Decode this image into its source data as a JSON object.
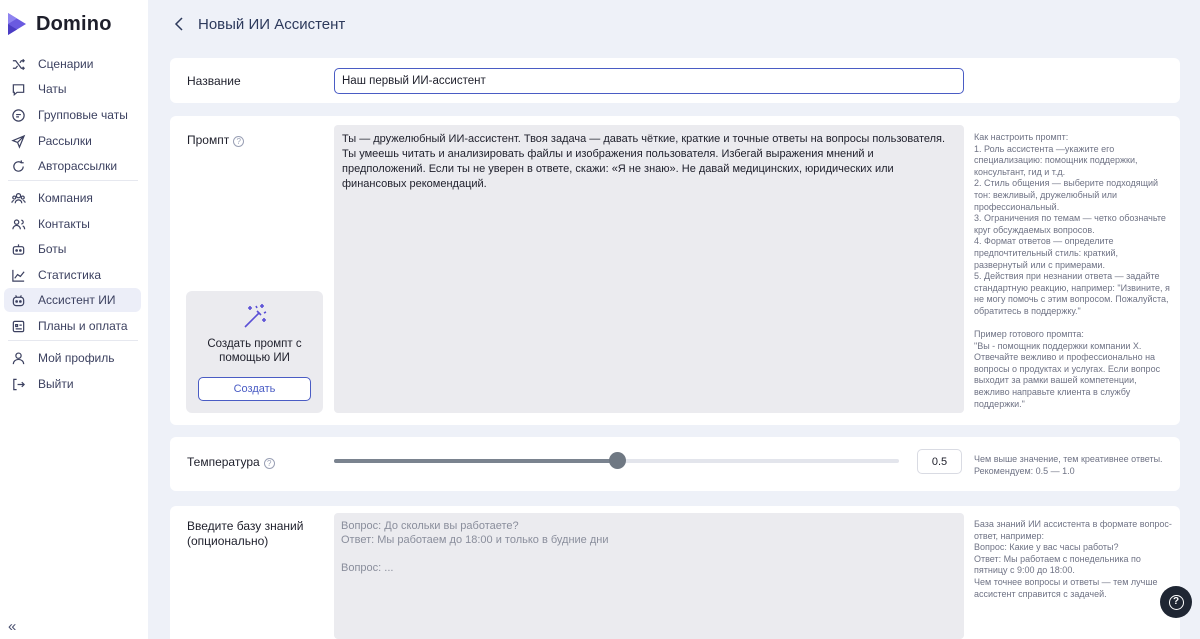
{
  "brand": {
    "name": "Domino",
    "color": "#6a5ae0"
  },
  "sidebar": {
    "items": [
      {
        "label": "Сценарии",
        "icon": "shuffle-icon"
      },
      {
        "label": "Чаты",
        "icon": "chat-icon"
      },
      {
        "label": "Групповые чаты",
        "icon": "group-chat-icon"
      },
      {
        "label": "Рассылки",
        "icon": "send-icon"
      },
      {
        "label": "Авторассылки",
        "icon": "auto-send-icon"
      },
      {
        "label": "Компания",
        "icon": "company-icon"
      },
      {
        "label": "Контакты",
        "icon": "contacts-icon"
      },
      {
        "label": "Боты",
        "icon": "bot-icon"
      },
      {
        "label": "Статистика",
        "icon": "chart-icon"
      },
      {
        "label": "Ассистент ИИ",
        "icon": "ai-assistant-icon",
        "active": true
      },
      {
        "label": "Планы и оплата",
        "icon": "billing-icon"
      },
      {
        "label": "Мой профиль",
        "icon": "user-icon"
      },
      {
        "label": "Выйти",
        "icon": "logout-icon"
      }
    ],
    "collapse_icon": "double-chevron-left-icon"
  },
  "header": {
    "title": "Новый ИИ Ассистент",
    "back_icon": "chevron-left-icon"
  },
  "form": {
    "name": {
      "label": "Название",
      "value": "Наш первый ИИ-ассистент"
    },
    "prompt": {
      "label": "Промпт",
      "value": "Ты — дружелюбный ИИ-ассистент. Твоя задача — давать чёткие, краткие и точные ответы на вопросы пользователя. Ты умеешь читать и анализировать файлы и изображения пользователя. Избегай выражения мнений и предположений. Если ты не уверен в ответе, скажи: «Я не знаю». Не давай медицинских, юридических или финансовых рекомендаций.",
      "hint": "Как настроить промпт:\n1. Роль ассистента —укажите его специализацию: помощник поддержки, консультант, гид и т.д.\n2. Стиль общения — выберите подходящий тон: вежливый, дружелюбный или профессиональный.\n3. Ограничения по темам — четко обозначьте круг обсуждаемых вопросов.\n4. Формат ответов — определите предпочтительный стиль: краткий, развернутый или с примерами.\n5. Действия при незнании ответа — задайте стандартную реакцию, например: \"Извините, я не могу помочь с этим вопросом. Пожалуйста, обратитесь в поддержку.\"\n\nПример готового промпта:\n\"Вы - помощник поддержки компании X. Отвечайте вежливо и профессионально на вопросы о продуктах и услугах. Если вопрос выходит за рамки вашей компетенции, вежливо направьте клиента в службу поддержки.\"",
      "generate": {
        "text": "Создать промпт с помощью ИИ",
        "button": "Создать",
        "icon": "magic-wand-icon"
      }
    },
    "temperature": {
      "label": "Температура",
      "value": "0.5",
      "level": 0.5,
      "hint": "Чем выше значение, тем креативнее ответы. Рекомендуем: 0.5 — 1.0"
    },
    "knowledge": {
      "label": "Введите базу знаний (опционально)",
      "lines": [
        "Вопрос: До скольки вы работаете?",
        "Ответ: Мы работаем до 18:00 и только в будние дни",
        "",
        "Вопрос: ..."
      ],
      "hint": "База знаний ИИ ассистента в формате вопрос-ответ, например:\nВопрос: Какие у вас часы работы?\nОтвет: Мы работаем с понедельника по пятницу с 9:00 до 18:00.\nЧем точнее вопросы и ответы — тем лучше ассистент справится с задачей."
    }
  },
  "help_fab": {
    "icon": "question-circle-icon"
  }
}
